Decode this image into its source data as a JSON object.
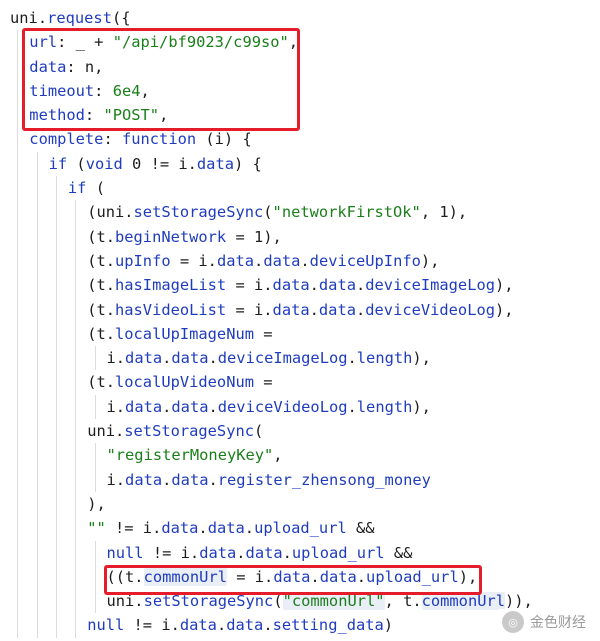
{
  "code": {
    "lines": [
      {
        "indent": 0,
        "tokens": [
          {
            "t": "uni",
            "c": "v"
          },
          {
            "t": ".",
            "c": "p"
          },
          {
            "t": "request",
            "c": "k"
          },
          {
            "t": "({",
            "c": "p"
          }
        ]
      },
      {
        "indent": 1,
        "tokens": [
          {
            "t": "url",
            "c": "k"
          },
          {
            "t": ": _ + ",
            "c": "p"
          },
          {
            "t": "\"/api/bf9023/c99so\"",
            "c": "s"
          },
          {
            "t": ",",
            "c": "p"
          }
        ]
      },
      {
        "indent": 1,
        "tokens": [
          {
            "t": "data",
            "c": "k"
          },
          {
            "t": ": n,",
            "c": "p"
          }
        ]
      },
      {
        "indent": 1,
        "tokens": [
          {
            "t": "timeout",
            "c": "k"
          },
          {
            "t": ": ",
            "c": "p"
          },
          {
            "t": "6e4",
            "c": "n"
          },
          {
            "t": ",",
            "c": "p"
          }
        ]
      },
      {
        "indent": 1,
        "tokens": [
          {
            "t": "method",
            "c": "k"
          },
          {
            "t": ": ",
            "c": "p"
          },
          {
            "t": "\"POST\"",
            "c": "s"
          },
          {
            "t": ",",
            "c": "p"
          }
        ]
      },
      {
        "indent": 1,
        "tokens": [
          {
            "t": "complete",
            "c": "k"
          },
          {
            "t": ": ",
            "c": "p"
          },
          {
            "t": "function",
            "c": "k"
          },
          {
            "t": " (i) {",
            "c": "p"
          }
        ]
      },
      {
        "indent": 2,
        "tokens": [
          {
            "t": "if",
            "c": "k"
          },
          {
            "t": " (",
            "c": "p"
          },
          {
            "t": "void",
            "c": "k"
          },
          {
            "t": " 0 != i.",
            "c": "p"
          },
          {
            "t": "data",
            "c": "k"
          },
          {
            "t": ") {",
            "c": "p"
          }
        ]
      },
      {
        "indent": 3,
        "tokens": [
          {
            "t": "if",
            "c": "k"
          },
          {
            "t": " (",
            "c": "p"
          }
        ]
      },
      {
        "indent": 4,
        "tokens": [
          {
            "t": "(uni.",
            "c": "p"
          },
          {
            "t": "setStorageSync",
            "c": "k"
          },
          {
            "t": "(",
            "c": "p"
          },
          {
            "t": "\"networkFirstOk\"",
            "c": "s"
          },
          {
            "t": ", 1),",
            "c": "p"
          }
        ]
      },
      {
        "indent": 4,
        "tokens": [
          {
            "t": "(t.",
            "c": "p"
          },
          {
            "t": "beginNetwork",
            "c": "k"
          },
          {
            "t": " = 1),",
            "c": "p"
          }
        ]
      },
      {
        "indent": 4,
        "tokens": [
          {
            "t": "(t.",
            "c": "p"
          },
          {
            "t": "upInfo",
            "c": "k"
          },
          {
            "t": " = i.",
            "c": "p"
          },
          {
            "t": "data",
            "c": "k"
          },
          {
            "t": ".",
            "c": "p"
          },
          {
            "t": "data",
            "c": "k"
          },
          {
            "t": ".",
            "c": "p"
          },
          {
            "t": "deviceUpInfo",
            "c": "k"
          },
          {
            "t": "),",
            "c": "p"
          }
        ]
      },
      {
        "indent": 4,
        "tokens": [
          {
            "t": "(t.",
            "c": "p"
          },
          {
            "t": "hasImageList",
            "c": "k"
          },
          {
            "t": " = i.",
            "c": "p"
          },
          {
            "t": "data",
            "c": "k"
          },
          {
            "t": ".",
            "c": "p"
          },
          {
            "t": "data",
            "c": "k"
          },
          {
            "t": ".",
            "c": "p"
          },
          {
            "t": "deviceImageLog",
            "c": "k"
          },
          {
            "t": "),",
            "c": "p"
          }
        ]
      },
      {
        "indent": 4,
        "tokens": [
          {
            "t": "(t.",
            "c": "p"
          },
          {
            "t": "hasVideoList",
            "c": "k"
          },
          {
            "t": " = i.",
            "c": "p"
          },
          {
            "t": "data",
            "c": "k"
          },
          {
            "t": ".",
            "c": "p"
          },
          {
            "t": "data",
            "c": "k"
          },
          {
            "t": ".",
            "c": "p"
          },
          {
            "t": "deviceVideoLog",
            "c": "k"
          },
          {
            "t": "),",
            "c": "p"
          }
        ]
      },
      {
        "indent": 4,
        "tokens": [
          {
            "t": "(t.",
            "c": "p"
          },
          {
            "t": "localUpImageNum",
            "c": "k"
          },
          {
            "t": " =",
            "c": "p"
          }
        ]
      },
      {
        "indent": 5,
        "tokens": [
          {
            "t": "i.",
            "c": "p"
          },
          {
            "t": "data",
            "c": "k"
          },
          {
            "t": ".",
            "c": "p"
          },
          {
            "t": "data",
            "c": "k"
          },
          {
            "t": ".",
            "c": "p"
          },
          {
            "t": "deviceImageLog",
            "c": "k"
          },
          {
            "t": ".",
            "c": "p"
          },
          {
            "t": "length",
            "c": "k"
          },
          {
            "t": "),",
            "c": "p"
          }
        ]
      },
      {
        "indent": 4,
        "tokens": [
          {
            "t": "(t.",
            "c": "p"
          },
          {
            "t": "localUpVideoNum",
            "c": "k"
          },
          {
            "t": " =",
            "c": "p"
          }
        ]
      },
      {
        "indent": 5,
        "tokens": [
          {
            "t": "i.",
            "c": "p"
          },
          {
            "t": "data",
            "c": "k"
          },
          {
            "t": ".",
            "c": "p"
          },
          {
            "t": "data",
            "c": "k"
          },
          {
            "t": ".",
            "c": "p"
          },
          {
            "t": "deviceVideoLog",
            "c": "k"
          },
          {
            "t": ".",
            "c": "p"
          },
          {
            "t": "length",
            "c": "k"
          },
          {
            "t": "),",
            "c": "p"
          }
        ]
      },
      {
        "indent": 4,
        "tokens": [
          {
            "t": "uni.",
            "c": "p"
          },
          {
            "t": "setStorageSync",
            "c": "k"
          },
          {
            "t": "(",
            "c": "p"
          }
        ]
      },
      {
        "indent": 5,
        "tokens": [
          {
            "t": "\"registerMoneyKey\"",
            "c": "s"
          },
          {
            "t": ",",
            "c": "p"
          }
        ]
      },
      {
        "indent": 5,
        "tokens": [
          {
            "t": "i.",
            "c": "p"
          },
          {
            "t": "data",
            "c": "k"
          },
          {
            "t": ".",
            "c": "p"
          },
          {
            "t": "data",
            "c": "k"
          },
          {
            "t": ".",
            "c": "p"
          },
          {
            "t": "register_zhensong_money",
            "c": "k"
          }
        ]
      },
      {
        "indent": 4,
        "tokens": [
          {
            "t": "),",
            "c": "p"
          }
        ]
      },
      {
        "indent": 4,
        "tokens": [
          {
            "t": "\"\"",
            "c": "s"
          },
          {
            "t": " != i.",
            "c": "p"
          },
          {
            "t": "data",
            "c": "k"
          },
          {
            "t": ".",
            "c": "p"
          },
          {
            "t": "data",
            "c": "k"
          },
          {
            "t": ".",
            "c": "p"
          },
          {
            "t": "upload_url",
            "c": "k"
          },
          {
            "t": " &&",
            "c": "p"
          }
        ]
      },
      {
        "indent": 5,
        "tokens": [
          {
            "t": "null",
            "c": "k"
          },
          {
            "t": " != i.",
            "c": "p"
          },
          {
            "t": "data",
            "c": "k"
          },
          {
            "t": ".",
            "c": "p"
          },
          {
            "t": "data",
            "c": "k"
          },
          {
            "t": ".",
            "c": "p"
          },
          {
            "t": "upload_url",
            "c": "k"
          },
          {
            "t": " &&",
            "c": "p"
          }
        ]
      },
      {
        "indent": 5,
        "tokens": [
          {
            "t": "((t.",
            "c": "p"
          },
          {
            "t": "commonUrl",
            "c": "k",
            "hl": true
          },
          {
            "t": " = i.",
            "c": "p"
          },
          {
            "t": "data",
            "c": "k"
          },
          {
            "t": ".",
            "c": "p"
          },
          {
            "t": "data",
            "c": "k"
          },
          {
            "t": ".",
            "c": "p"
          },
          {
            "t": "upload_url",
            "c": "k"
          },
          {
            "t": "),",
            "c": "p"
          }
        ]
      },
      {
        "indent": 5,
        "tokens": [
          {
            "t": "uni.",
            "c": "p"
          },
          {
            "t": "setStorageSync",
            "c": "k"
          },
          {
            "t": "(",
            "c": "p"
          },
          {
            "t": "\"commonUrl\"",
            "c": "s",
            "hl": true
          },
          {
            "t": ", t.",
            "c": "p"
          },
          {
            "t": "commonUrl",
            "c": "k",
            "hl": true
          },
          {
            "t": ")),",
            "c": "p"
          }
        ]
      },
      {
        "indent": 4,
        "tokens": [
          {
            "t": "null",
            "c": "k"
          },
          {
            "t": " != i.",
            "c": "p"
          },
          {
            "t": "data",
            "c": "k"
          },
          {
            "t": ".",
            "c": "p"
          },
          {
            "t": "data",
            "c": "k"
          },
          {
            "t": ".",
            "c": "p"
          },
          {
            "t": "setting_data",
            "c": "k"
          },
          {
            "t": ")",
            "c": "p"
          }
        ]
      }
    ]
  },
  "watermark": {
    "text": "金色财经",
    "logo_icon": "coin-logo-icon",
    "logo_glyph": "◎"
  },
  "colors": {
    "highlight_box": "#e51d2b",
    "keyword": "#1f3cbf",
    "string": "#1a7f1a"
  }
}
